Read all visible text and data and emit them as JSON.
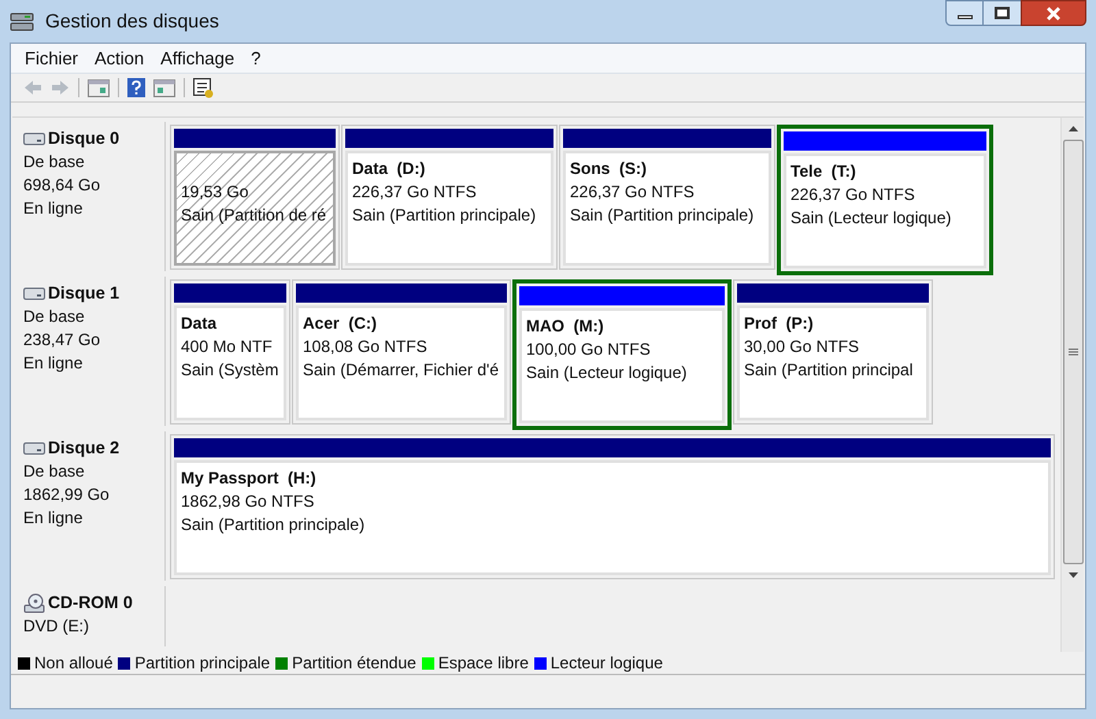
{
  "window": {
    "title": "Gestion des disques"
  },
  "menu": [
    {
      "label": "Fichier"
    },
    {
      "label": "Action"
    },
    {
      "label": "Affichage"
    },
    {
      "label": "?"
    }
  ],
  "disks": [
    {
      "name": "Disque 0",
      "kind": "disk",
      "lines": [
        "De base",
        "698,64 Go",
        "En ligne"
      ],
      "partitions": [
        {
          "kind": "primary",
          "selected": true,
          "size": "19,53 Go",
          "status": "Sain (Partition de ré"
        },
        {
          "kind": "primary",
          "selected": false,
          "name": "Data  (D:)",
          "size": "226,37 Go NTFS",
          "status": "Sain (Partition principale)"
        },
        {
          "kind": "primary",
          "selected": false,
          "name": "Sons  (S:)",
          "size": "226,37 Go NTFS",
          "status": "Sain (Partition principale)"
        },
        {
          "kind": "logical",
          "selected": false,
          "name": "Tele  (T:)",
          "size": "226,37 Go NTFS",
          "status": "Sain (Lecteur logique)"
        }
      ]
    },
    {
      "name": "Disque 1",
      "kind": "disk",
      "lines": [
        "De base",
        "238,47 Go",
        "En ligne"
      ],
      "partitions": [
        {
          "kind": "primary",
          "selected": false,
          "name": "Data",
          "size": "400 Mo NTF",
          "status": "Sain (Systèm"
        },
        {
          "kind": "primary",
          "selected": false,
          "name": "Acer  (C:)",
          "size": "108,08 Go NTFS",
          "status": "Sain (Démarrer, Fichier d'é"
        },
        {
          "kind": "logical",
          "selected": false,
          "name": "MAO  (M:)",
          "size": "100,00 Go NTFS",
          "status": "Sain (Lecteur logique)"
        },
        {
          "kind": "primary",
          "selected": false,
          "name": "Prof  (P:)",
          "size": "30,00 Go NTFS",
          "status": "Sain (Partition principal"
        }
      ]
    },
    {
      "name": "Disque 2",
      "kind": "disk",
      "lines": [
        "De base",
        "1862,99 Go",
        "En ligne"
      ],
      "partitions": [
        {
          "kind": "primary",
          "selected": false,
          "name": "My Passport  (H:)",
          "size": "1862,98 Go NTFS",
          "status": "Sain (Partition principale)"
        }
      ]
    },
    {
      "name": "CD-ROM 0",
      "kind": "cdrom",
      "lines": [
        "DVD (E:)"
      ]
    }
  ],
  "legend": [
    {
      "label": "Non alloué",
      "color": "#000000"
    },
    {
      "label": "Partition principale",
      "color": "#000080"
    },
    {
      "label": "Partition étendue",
      "color": "#008000"
    },
    {
      "label": "Espace libre",
      "color": "#00ff00"
    },
    {
      "label": "Lecteur logique",
      "color": "#0000ff"
    }
  ]
}
